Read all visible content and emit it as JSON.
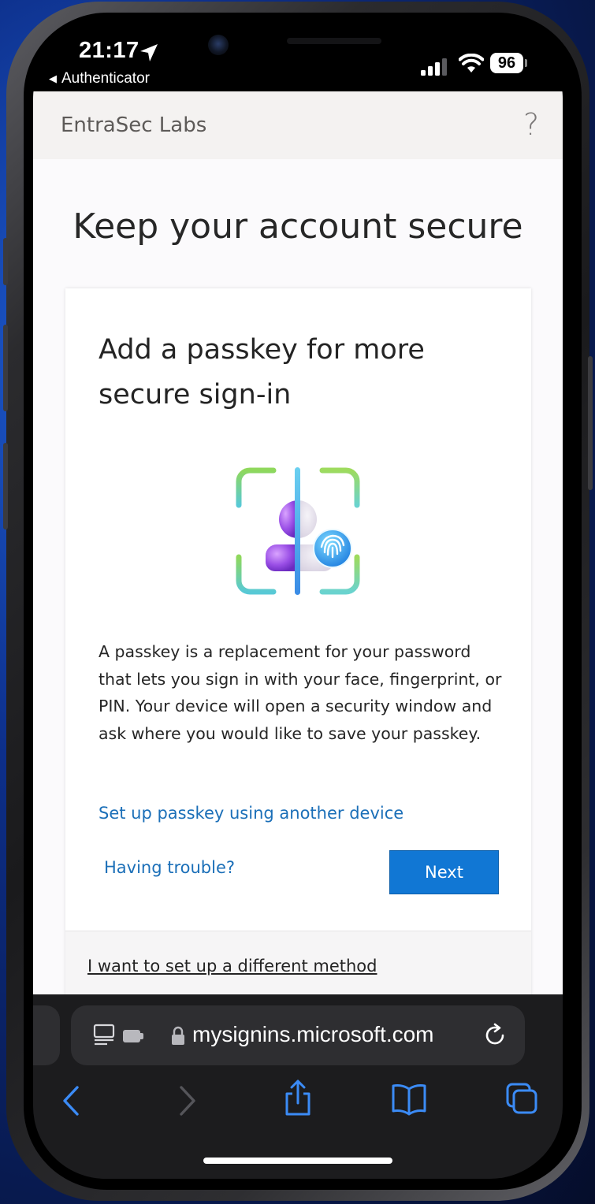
{
  "status_bar": {
    "time": "21:17",
    "back_app": "Authenticator",
    "battery": "96"
  },
  "header": {
    "brand": "EntraSec Labs",
    "help_icon": "?"
  },
  "page": {
    "title": "Keep your account secure"
  },
  "card": {
    "title": "Add a passkey for more secure sign-in",
    "illustration_icon": "passkey-person-fingerprint-icon",
    "description": "A passkey is a replacement for your password that lets you sign in with your face, fingerprint, or PIN. Your device will open a security window and ask where you would like to save your passkey.",
    "link_another_device": "Set up passkey using another device",
    "link_trouble": "Having trouble?",
    "next_button": "Next",
    "link_different_method": "I want to set up a different method"
  },
  "browser": {
    "url": "mysignins.microsoft.com",
    "icons": [
      "reader-icon",
      "extension-icon",
      "lock-icon",
      "reload-icon",
      "back-icon",
      "forward-icon",
      "share-icon",
      "bookmarks-icon",
      "tabs-icon"
    ]
  },
  "colors": {
    "accent": "#1177d4",
    "link": "#1b6fb8",
    "header_bg": "#f4f2f1",
    "browser_icon": "#3b8bf6"
  }
}
